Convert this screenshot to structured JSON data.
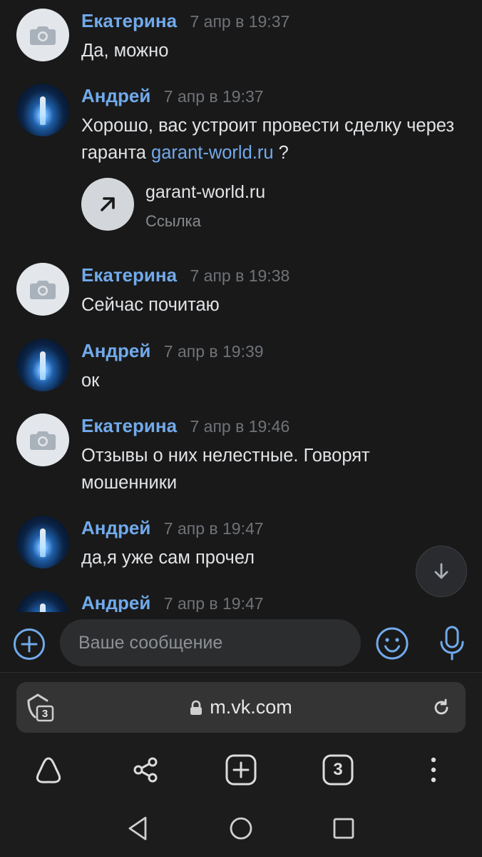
{
  "messages": [
    {
      "author": "Екатерина",
      "time": "7 апр в 19:37",
      "text": "Да, можно",
      "avatar": "camera-placeholder"
    },
    {
      "author": "Андрей",
      "time": "7 апр в 19:37",
      "text_before": "Хорошо, вас устроит провести сделку через гаранта ",
      "link": "garant-world.ru",
      "text_after": " ?",
      "attachment": {
        "title": "garant-world.ru",
        "subtitle": "Ссылка",
        "icon": "arrow-up-right-icon"
      },
      "avatar": "photo"
    },
    {
      "author": "Екатерина",
      "time": "7 апр в 19:38",
      "text": "Сейчас почитаю",
      "avatar": "camera-placeholder"
    },
    {
      "author": "Андрей",
      "time": "7 апр в 19:39",
      "text": "ок",
      "avatar": "photo"
    },
    {
      "author": "Екатерина",
      "time": "7 апр в 19:46",
      "text": "Отзывы о них нелестные. Говорят мошенники",
      "avatar": "camera-placeholder"
    },
    {
      "author": "Андрей",
      "time": "7 апр в 19:47",
      "text": "да,я уже сам прочел",
      "avatar": "photo"
    },
    {
      "author": "Андрей",
      "time": "7 апр в 19:47",
      "text": "",
      "avatar": "photo"
    }
  ],
  "composer": {
    "placeholder": "Ваше сообщение"
  },
  "browser": {
    "url": "m.vk.com",
    "tab_count": "3",
    "shield_count": "3"
  },
  "colors": {
    "accent": "#71aaeb",
    "background": "#191919",
    "muted": "#6f7378"
  }
}
